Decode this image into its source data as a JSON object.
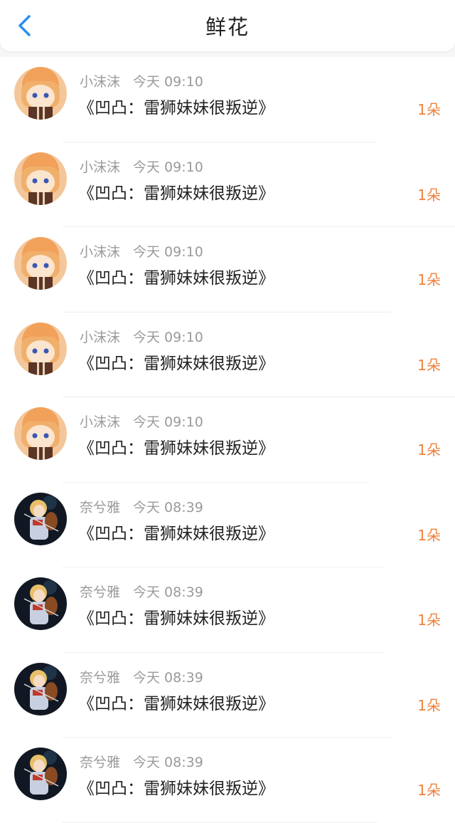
{
  "header": {
    "title": "鲜花",
    "back_label": "<"
  },
  "rows": [
    {
      "user": "小沫沫",
      "time": "今天 09:10",
      "work": "《凹凸：雷狮妹妹很叛逆》",
      "count": "1朵",
      "avatar": "avatar-orange"
    },
    {
      "user": "小沫沫",
      "time": "今天 09:10",
      "work": "《凹凸：雷狮妹妹很叛逆》",
      "count": "1朵",
      "avatar": "avatar-orange"
    },
    {
      "user": "小沫沫",
      "time": "今天 09:10",
      "work": "《凹凸：雷狮妹妹很叛逆》",
      "count": "1朵",
      "avatar": "avatar-orange"
    },
    {
      "user": "小沫沫",
      "time": "今天 09:10",
      "work": "《凹凸：雷狮妹妹很叛逆》",
      "count": "1朵",
      "avatar": "avatar-orange"
    },
    {
      "user": "小沫沫",
      "time": "今天 09:10",
      "work": "《凹凸：雷狮妹妹很叛逆》",
      "count": "1朵",
      "avatar": "avatar-orange"
    },
    {
      "user": "奈兮雅",
      "time": "今天 08:39",
      "work": "《凹凸：雷狮妹妹很叛逆》",
      "count": "1朵",
      "avatar": "avatar-violin"
    },
    {
      "user": "奈兮雅",
      "time": "今天 08:39",
      "work": "《凹凸：雷狮妹妹很叛逆》",
      "count": "1朵",
      "avatar": "avatar-violin"
    },
    {
      "user": "奈兮雅",
      "time": "今天 08:39",
      "work": "《凹凸：雷狮妹妹很叛逆》",
      "count": "1朵",
      "avatar": "avatar-violin"
    },
    {
      "user": "奈兮雅",
      "time": "今天 08:39",
      "work": "《凹凸：雷狮妹妹很叛逆》",
      "count": "1朵",
      "avatar": "avatar-violin"
    }
  ],
  "colors": {
    "accent": "#2b8ff0",
    "count": "#f0813c",
    "meta": "#9a9a9a",
    "text": "#222222"
  }
}
